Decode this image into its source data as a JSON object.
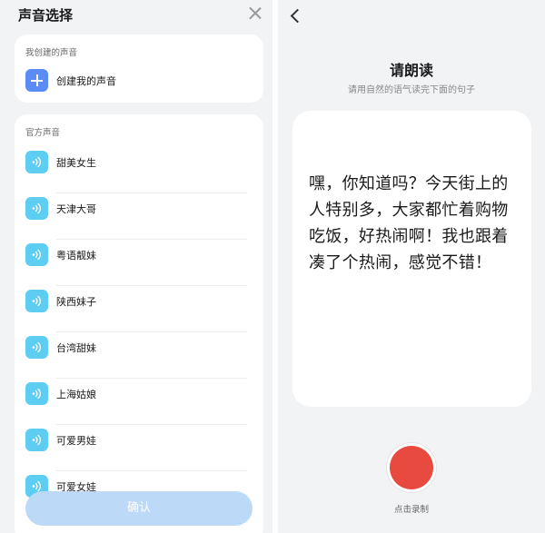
{
  "left_panel": {
    "title": "声音选择",
    "close_icon": "close-icon",
    "my_voices": {
      "section_label": "我创建的声音",
      "create_label": "创建我的声音",
      "icon": "plus-icon"
    },
    "official": {
      "section_label": "官方声音",
      "icon": "sound-wave-icon",
      "items": [
        {
          "label": "甜美女生"
        },
        {
          "label": "天津大哥"
        },
        {
          "label": "粤语靓妹"
        },
        {
          "label": "陕西妹子"
        },
        {
          "label": "台湾甜妹"
        },
        {
          "label": "上海姑娘"
        },
        {
          "label": "可爱男娃"
        },
        {
          "label": "可爱女娃"
        }
      ]
    },
    "confirm_label": "确认"
  },
  "right_panel": {
    "back_icon": "chevron-left-icon",
    "title": "请朗读",
    "subtitle": "请用自然的语气读完下面的句子",
    "sentence": "嘿，你知道吗？今天街上的人特别多，大家都忙着购物吃饭，好热闹啊！我也跟着凑了个热闹，感觉不错！",
    "record_label": "点击录制"
  },
  "colors": {
    "background": "#f2f3f5",
    "card": "#ffffff",
    "plus_icon": "#5b8cf5",
    "voice_icon": "#5dcdf2",
    "confirm_button": "#bcd9f7",
    "record_button": "#e84a3f"
  }
}
